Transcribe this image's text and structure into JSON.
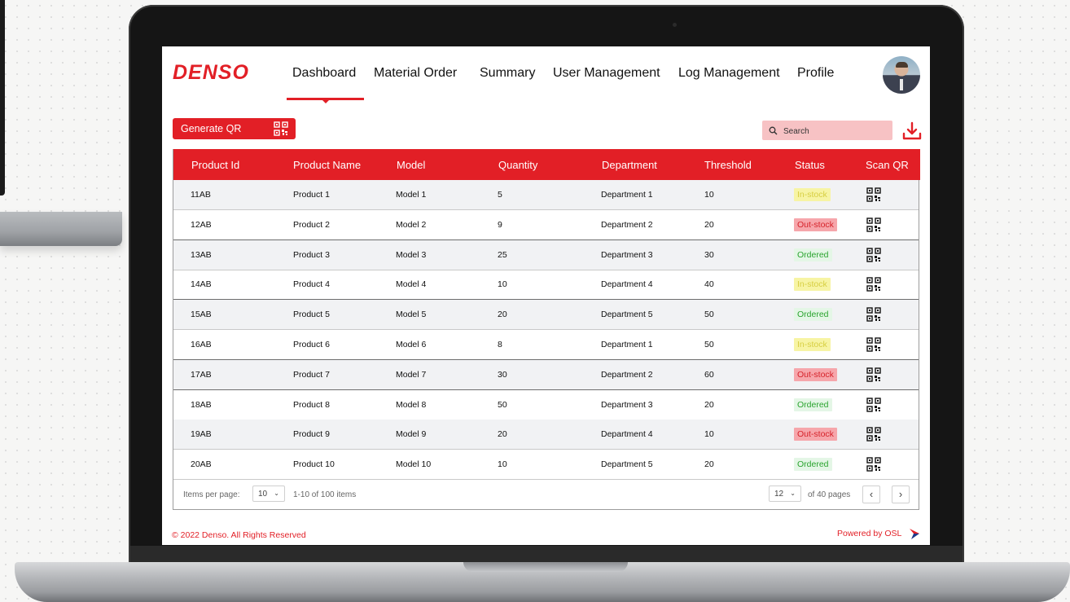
{
  "brand": {
    "logo": "DENSO",
    "accent": "#e21f26"
  },
  "nav": {
    "items": [
      {
        "label": "Dashboard",
        "active": true
      },
      {
        "label": "Material Order"
      },
      {
        "label": "Summary"
      },
      {
        "label": "User Management"
      },
      {
        "label": "Log Management"
      },
      {
        "label": "Profile"
      }
    ]
  },
  "toolbar": {
    "generate_qr_label": "Generate QR",
    "search_placeholder": "Search",
    "download_icon": "download-icon"
  },
  "table": {
    "headers": [
      "Product Id",
      "Product Name",
      "Model",
      "Quantity",
      "Department",
      "Threshold",
      "Status",
      "Scan QR"
    ],
    "rows": [
      {
        "id": "11AB",
        "name": "Product 1",
        "model": "Model 1",
        "quantity": "5",
        "department": "Department 1",
        "threshold": "10",
        "status": "In-stock"
      },
      {
        "id": "12AB",
        "name": "Product 2",
        "model": "Model 2",
        "quantity": "9",
        "department": "Department 2",
        "threshold": "20",
        "status": "Out-stock"
      },
      {
        "id": "13AB",
        "name": "Product 3",
        "model": "Model 3",
        "quantity": "25",
        "department": "Department 3",
        "threshold": "30",
        "status": "Ordered"
      },
      {
        "id": "14AB",
        "name": "Product 4",
        "model": "Model 4",
        "quantity": "10",
        "department": "Department 4",
        "threshold": "40",
        "status": "In-stock"
      },
      {
        "id": "15AB",
        "name": "Product 5",
        "model": "Model 5",
        "quantity": "20",
        "department": "Department 5",
        "threshold": "50",
        "status": "Ordered"
      },
      {
        "id": "16AB",
        "name": "Product 6",
        "model": "Model 6",
        "quantity": "8",
        "department": "Department 1",
        "threshold": "50",
        "status": "In-stock"
      },
      {
        "id": "17AB",
        "name": "Product 7",
        "model": "Model 7",
        "quantity": "30",
        "department": "Department 2",
        "threshold": "60",
        "status": "Out-stock"
      },
      {
        "id": "18AB",
        "name": "Product 8",
        "model": "Model 8",
        "quantity": "50",
        "department": "Department 3",
        "threshold": "20",
        "status": "Ordered"
      },
      {
        "id": "19AB",
        "name": "Product 9",
        "model": "Model 9",
        "quantity": "20",
        "department": "Department 4",
        "threshold": "10",
        "status": "Out-stock"
      },
      {
        "id": "20AB",
        "name": "Product 10",
        "model": "Model 10",
        "quantity": "10",
        "department": "Department 5",
        "threshold": "20",
        "status": "Ordered"
      }
    ]
  },
  "pagination": {
    "items_per_page_label": "Items per page:",
    "items_per_page": "10",
    "range_text": "1-10 of 100 items",
    "current_page": "12",
    "of_pages_text": "of 40 pages",
    "prev": "‹",
    "next": "›"
  },
  "footer": {
    "copyright": "© 2022 Denso. All Rights Reserved",
    "powered": "Powered by OSL"
  }
}
